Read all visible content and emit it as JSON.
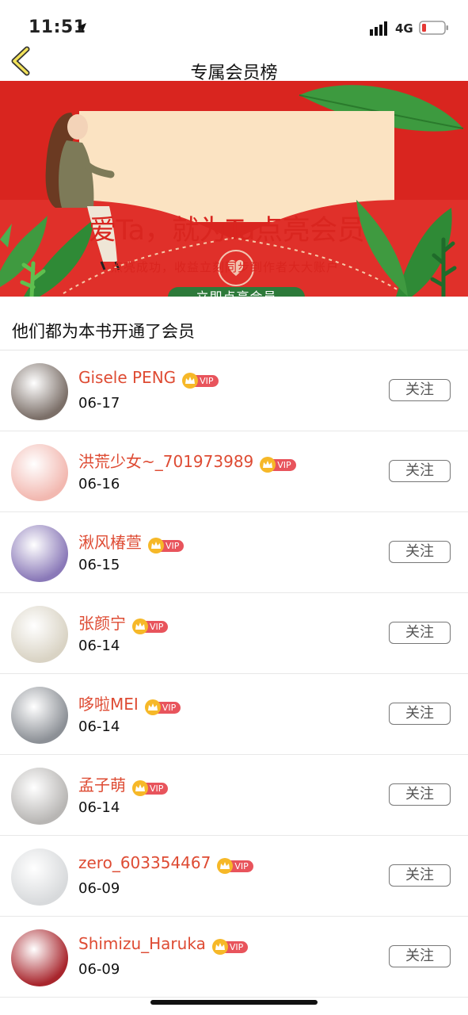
{
  "status_bar": {
    "time": "11:51",
    "network": "4G"
  },
  "nav": {
    "title": "专属会员榜"
  },
  "banner": {
    "headline": "爱Ta，就为Ta点亮会员",
    "subtitle": "点亮成功，收益立刻同步到作者大大账户",
    "button_label": "立即点亮会员"
  },
  "section_title": "他们都为本书开通了会员",
  "vip_label": "VIP",
  "follow_label": "关注",
  "members": [
    {
      "name": "Gisele PENG",
      "date": "06-17",
      "avatar_color": "#7b6f68"
    },
    {
      "name": "洪荒少女~_701973989",
      "date": "06-16",
      "avatar_color": "#f2b8b0"
    },
    {
      "name": "湫风椿萱",
      "date": "06-15",
      "avatar_color": "#8a79b8"
    },
    {
      "name": "张颜宁",
      "date": "06-14",
      "avatar_color": "#d9d3c4"
    },
    {
      "name": "哆啦MEI",
      "date": "06-14",
      "avatar_color": "#8c9096"
    },
    {
      "name": "孟子萌",
      "date": "06-14",
      "avatar_color": "#b8b6b4"
    },
    {
      "name": "zero_603354467",
      "date": "06-09",
      "avatar_color": "#d8dadc"
    },
    {
      "name": "Shimizu_Haruka",
      "date": "06-09",
      "avatar_color": "#a8262d"
    }
  ],
  "colors": {
    "accent_red": "#de4b33",
    "banner_red": "#d9251f",
    "vip_gold": "#f6b828",
    "vip_pink": "#e8545c"
  }
}
